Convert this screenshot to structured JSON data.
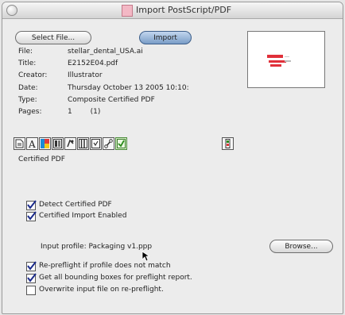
{
  "window": {
    "title": "Import PostScript/PDF"
  },
  "buttons": {
    "select_file": "Select File...",
    "import": "Import",
    "browse": "Browse..."
  },
  "info": [
    {
      "label": "File:",
      "value": "stellar_dental_USA.ai"
    },
    {
      "label": "Title:",
      "value": "E2152E04.pdf"
    },
    {
      "label": "Creator:",
      "value": "Illustrator"
    },
    {
      "label": "Date:",
      "value": "Thursday October 13 2005 10:10:"
    },
    {
      "label": "Type:",
      "value": "Composite Certified PDF"
    },
    {
      "label": "Pages:",
      "value": "1        (1)"
    }
  ],
  "toolbar": {
    "icons": [
      "document-icon",
      "font-icon",
      "color-icon",
      "layout-icon",
      "image-icon",
      "columns-icon",
      "form-icon",
      "links-icon",
      "certified-check-icon",
      "trap-icon"
    ],
    "active": "certified-check-icon"
  },
  "certified": {
    "section_title": "Certified PDF",
    "detect": {
      "label": "Detect Certified PDF",
      "checked": true
    },
    "import_enabled": {
      "label": "Certified Import Enabled",
      "checked": true
    },
    "input_profile": "Input profile: Packaging v1.ppp",
    "reprofile": {
      "label": "Re-preflight if profile does not match",
      "checked": true
    },
    "bounding": {
      "label": "Get all bounding boxes for preflight report.",
      "checked": true
    },
    "overwrite": {
      "label": "Overwrite input file on re-preflight.",
      "checked": false
    }
  },
  "colors": {
    "default_button": "#7a9dc7",
    "preview_red": "#e0303a"
  }
}
